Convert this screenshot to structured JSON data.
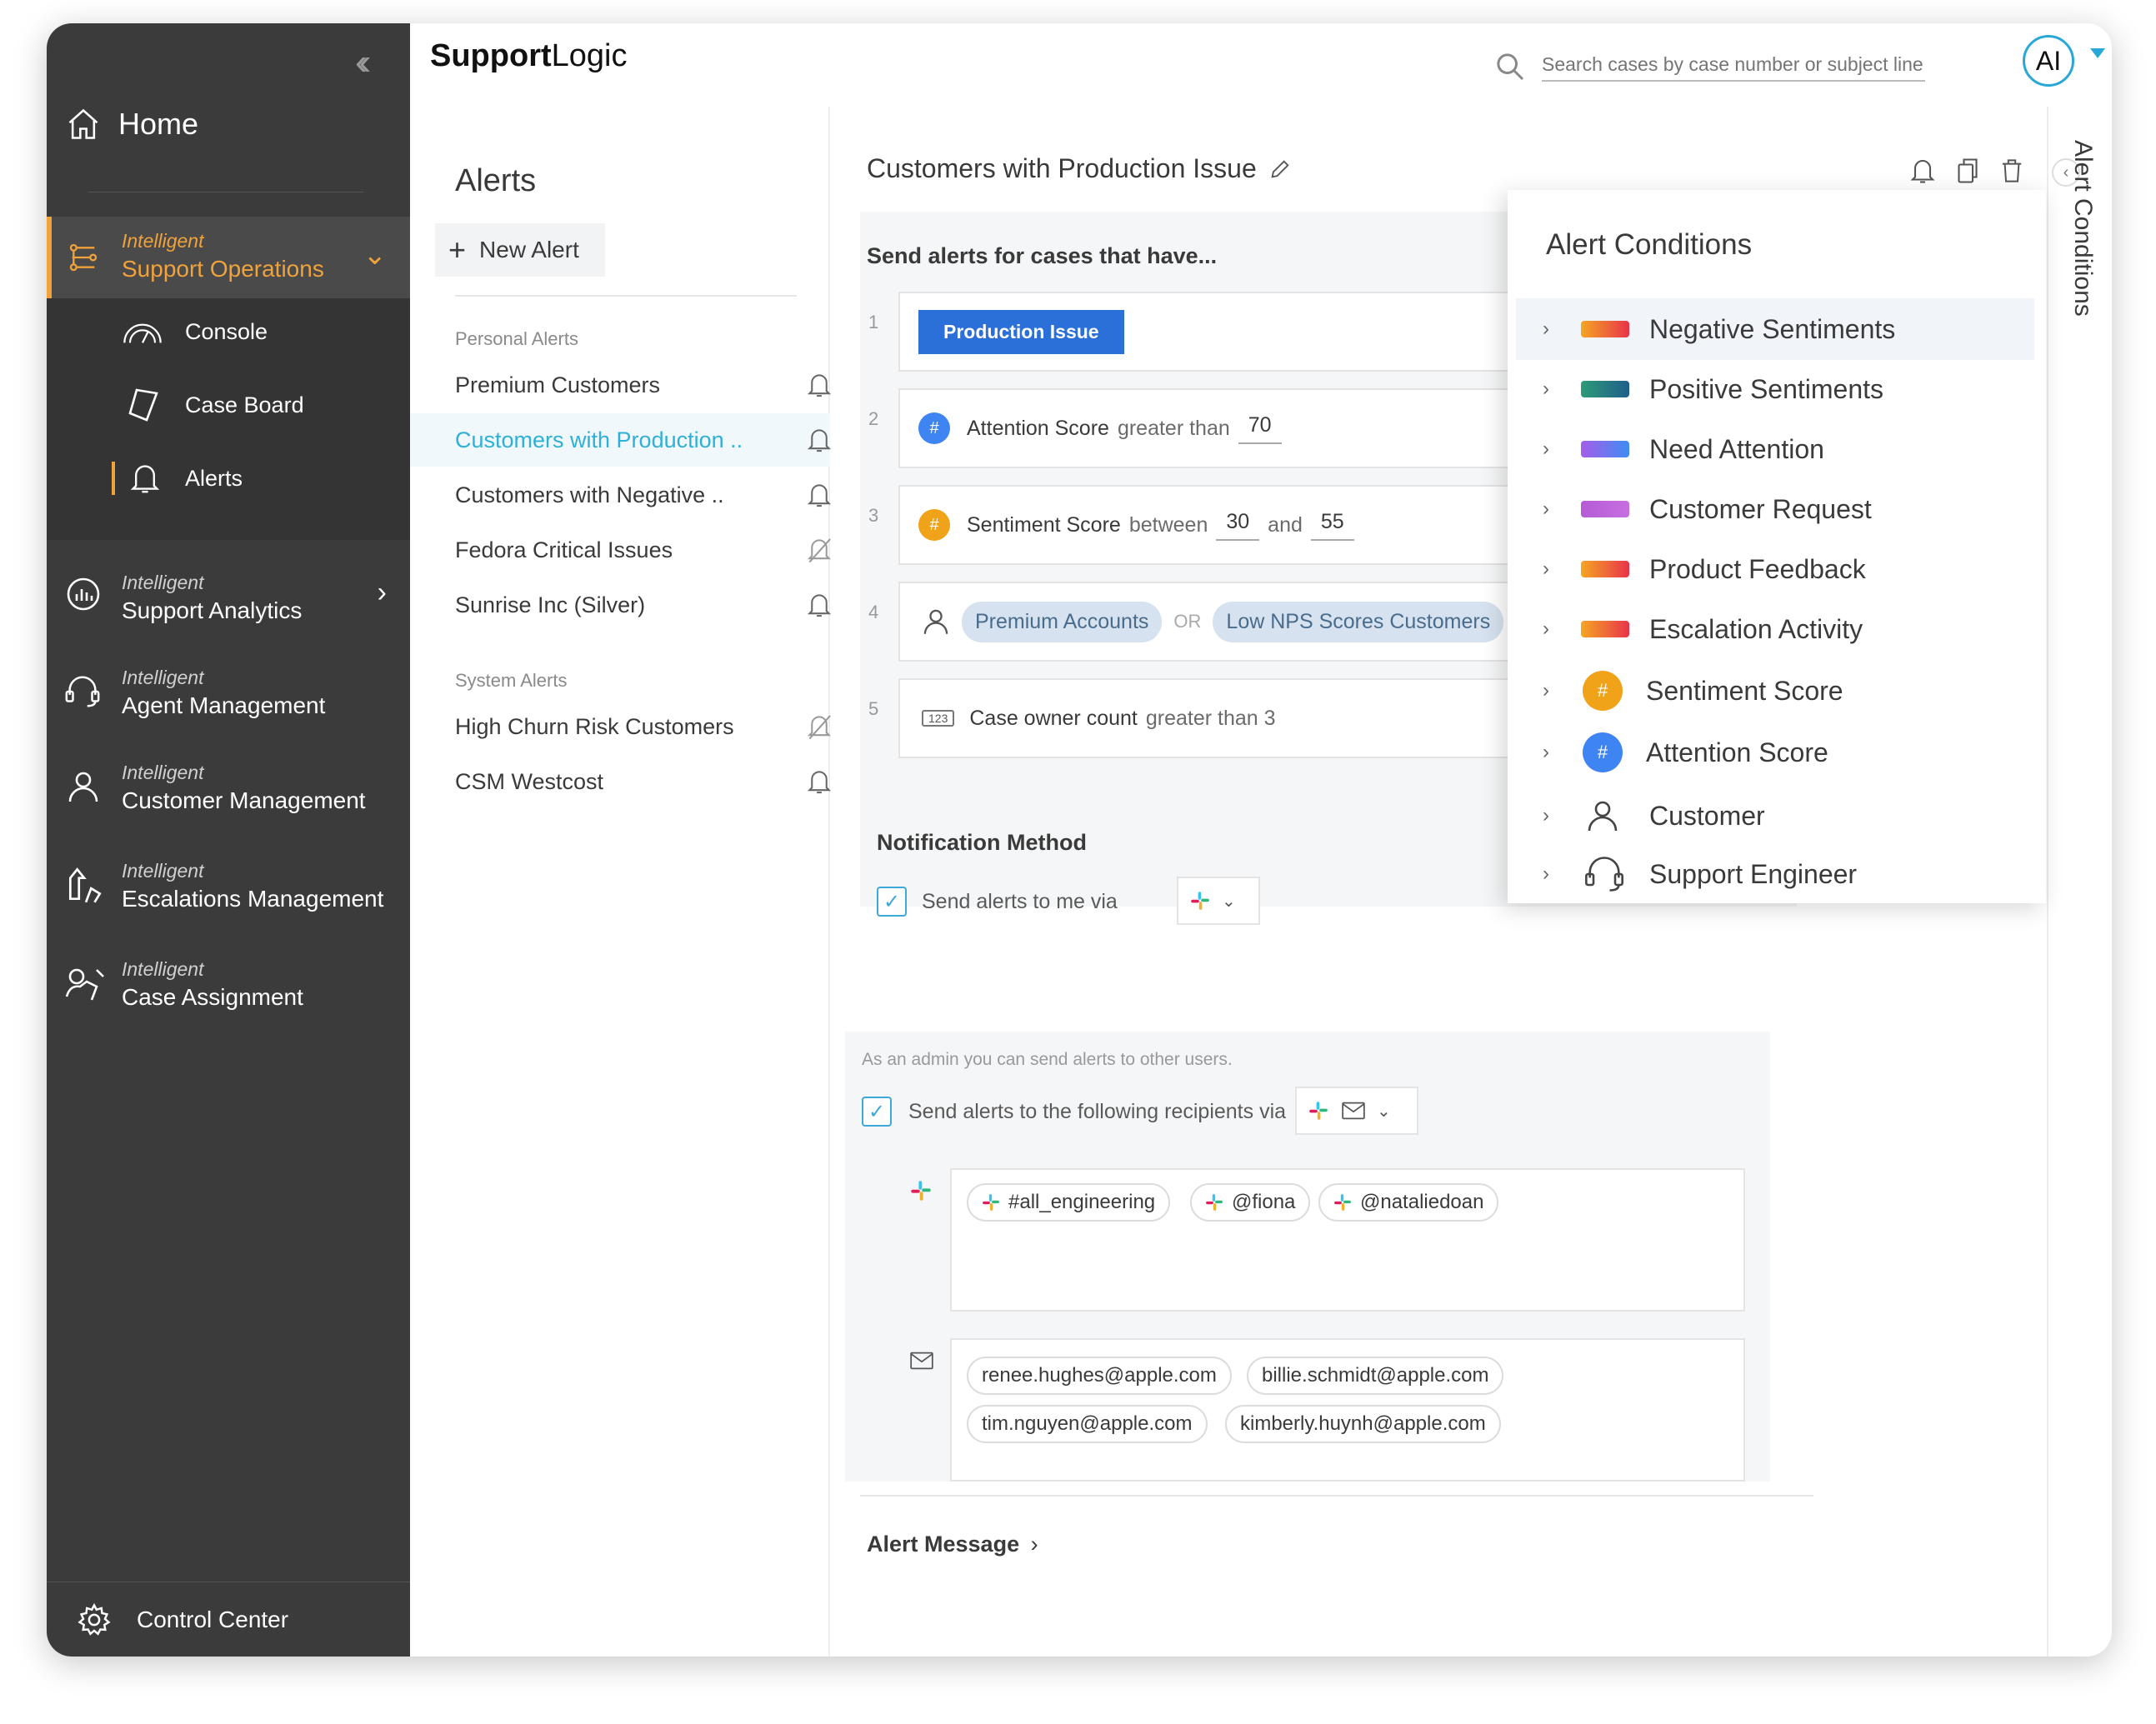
{
  "app": {
    "logo_bold": "Support",
    "logo_rest": "Logic"
  },
  "search": {
    "placeholder": "Search cases by case number or subject line"
  },
  "user": {
    "initials": "AI"
  },
  "sidebar": {
    "home": "Home",
    "groups": [
      {
        "small": "Intelligent",
        "big": "Support Operations"
      },
      {
        "small": "Intelligent",
        "big": "Support Analytics"
      },
      {
        "small": "Intelligent",
        "big": "Agent Management"
      },
      {
        "small": "Intelligent",
        "big": "Customer Management"
      },
      {
        "small": "Intelligent",
        "big": "Escalations Management"
      },
      {
        "small": "Intelligent",
        "big": "Case Assignment"
      }
    ],
    "sub_items": [
      "Console",
      "Case Board",
      "Alerts"
    ],
    "control_center": "Control Center"
  },
  "alerts_list": {
    "title": "Alerts",
    "new_alert": "New Alert",
    "personal_label": "Personal Alerts",
    "personal": [
      "Premium Customers",
      "Customers with Production ..",
      "Customers with Negative ..",
      "Fedora Critical Issues",
      "Sunrise Inc (Silver)"
    ],
    "system_label": "System Alerts",
    "system": [
      "High Churn Risk Customers",
      "CSM Westcost"
    ]
  },
  "editor": {
    "title": "Customers with Production Issue",
    "send_heading": "Send alerts for cases that have...",
    "row_numbers": [
      "1",
      "2",
      "3",
      "4",
      "5"
    ],
    "cond1": {
      "label": "Production Issue"
    },
    "cond2": {
      "field": "Attention Score",
      "op": "greater than",
      "value": "70"
    },
    "cond3": {
      "field": "Sentiment Score",
      "op": "between",
      "v1": "30",
      "and": "and",
      "v2": "55"
    },
    "cond4": {
      "tag1": "Premium Accounts",
      "or": "OR",
      "tag2": "Low NPS Scores Customers"
    },
    "cond5": {
      "badge": "123",
      "field": "Case owner count",
      "op": "greater than 3"
    },
    "notif_heading": "Notification Method",
    "send_me": "Send alerts to me via",
    "admin_note": "As an admin you can send alerts to other users.",
    "send_recipients": "Send alerts to the following recipients via",
    "slack_chips": [
      "#all_engineering",
      "@fiona",
      "@nataliedoan"
    ],
    "email_chips": [
      "renee.hughes@apple.com",
      "billie.schmidt@apple.com",
      "tim.nguyen@apple.com",
      "kimberly.huynh@apple.com"
    ],
    "alert_message": "Alert Message"
  },
  "conditions_panel": {
    "title": "Alert Conditions",
    "vertical_label": "Alert Conditions",
    "items": [
      {
        "label": "Negative Sentiments"
      },
      {
        "label": "Positive Sentiments"
      },
      {
        "label": "Need Attention"
      },
      {
        "label": "Customer Request"
      },
      {
        "label": "Product Feedback"
      },
      {
        "label": "Escalation Activity"
      },
      {
        "label": "Sentiment Score",
        "badge": "#"
      },
      {
        "label": "Attention Score",
        "badge": "#"
      },
      {
        "label": "Customer"
      },
      {
        "label": "Support Engineer"
      }
    ]
  },
  "colors": {
    "accent_orange": "#f0a23b",
    "accent_blue": "#2fb0d6",
    "primary_blue": "#2b6fd8"
  }
}
